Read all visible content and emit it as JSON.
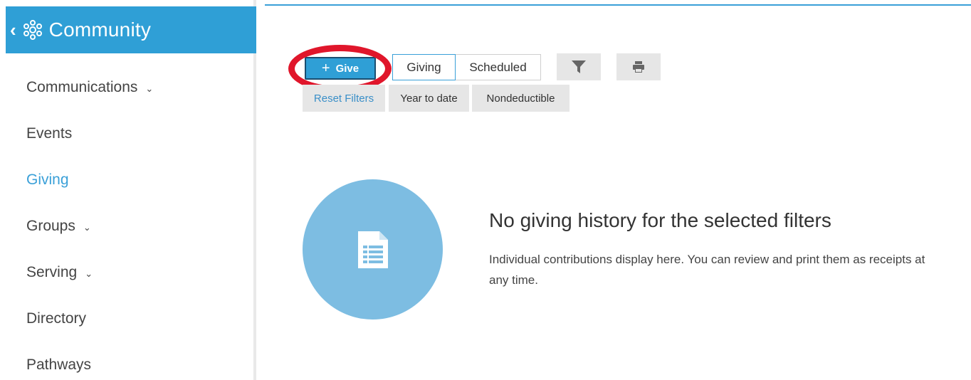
{
  "sidebar": {
    "back_glyph": "‹",
    "title": "Community",
    "icon": "community-icon",
    "items": [
      {
        "label": "Communications",
        "chevron": "⌄",
        "active": false
      },
      {
        "label": "Events",
        "active": false
      },
      {
        "label": "Giving",
        "active": true
      },
      {
        "label": "Groups",
        "chevron": "⌄",
        "active": false
      },
      {
        "label": "Serving",
        "chevron": "⌄",
        "active": false
      },
      {
        "label": "Directory",
        "active": false
      },
      {
        "label": "Pathways",
        "active": false
      }
    ]
  },
  "toolbar": {
    "give_plus": "+",
    "give_label": "Give",
    "tabs": [
      {
        "label": "Giving",
        "active": true
      },
      {
        "label": "Scheduled",
        "active": false
      }
    ],
    "filter_icon": "filter-icon",
    "print_icon": "print-icon"
  },
  "filters": {
    "reset_label": "Reset Filters",
    "chips": [
      "Year to date",
      "Nondeductible"
    ]
  },
  "empty_state": {
    "icon": "document-list-icon",
    "title": "No giving history for the selected filters",
    "description": "Individual contributions display here. You can review and print them as receipts at any time."
  },
  "colors": {
    "brand": "#2f9fd6",
    "active_link": "#3aa0d8",
    "annotation_ring": "#e0162b",
    "empty_circle": "#7dbde2"
  }
}
